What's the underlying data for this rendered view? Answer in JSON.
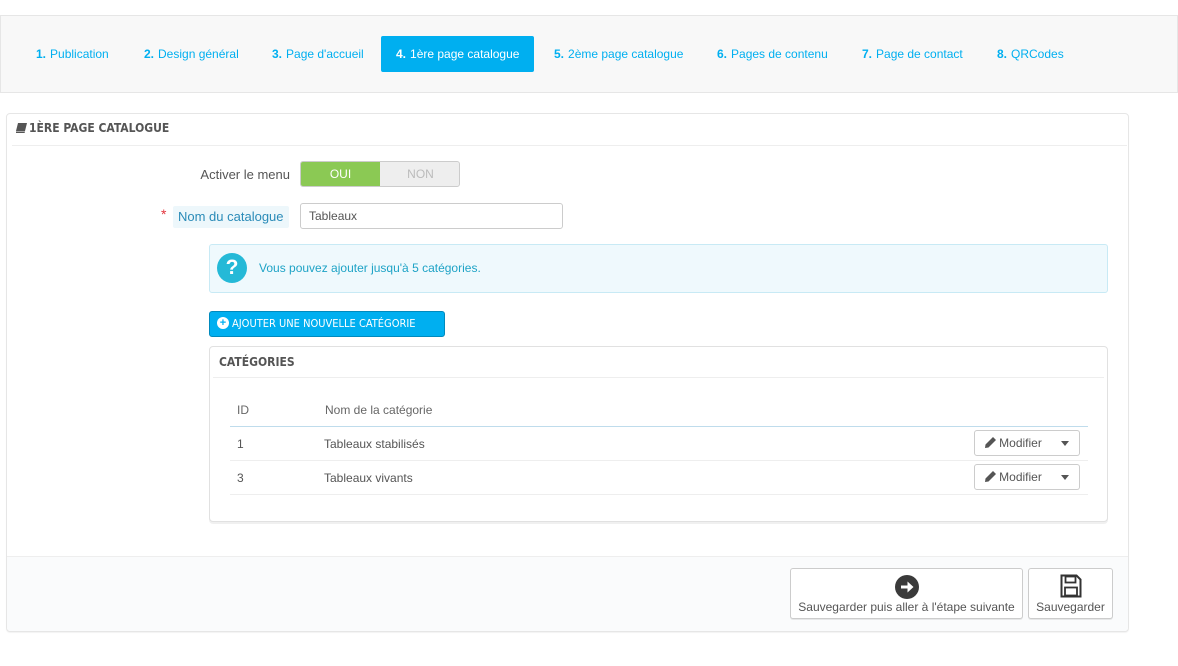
{
  "steps": [
    {
      "num": "1.",
      "label": "Publication"
    },
    {
      "num": "2.",
      "label": "Design général"
    },
    {
      "num": "3.",
      "label": "Page d'accueil"
    },
    {
      "num": "4.",
      "label": "1ère page catalogue"
    },
    {
      "num": "5.",
      "label": "2ème page catalogue"
    },
    {
      "num": "6.",
      "label": "Pages de contenu"
    },
    {
      "num": "7.",
      "label": "Page de contact"
    },
    {
      "num": "8.",
      "label": "QRCodes"
    }
  ],
  "active_step": 3,
  "panel": {
    "title": "1ère page catalogue",
    "menu_label": "Activer le menu",
    "switch_on": "OUI",
    "switch_off": "NON",
    "switch_value": "OUI",
    "catalogue_label": "Nom du catalogue",
    "required_mark": "*",
    "catalogue_value": "Tableaux",
    "info_icon": "?",
    "info_text": "Vous pouvez ajouter jusqu'à 5 catégories.",
    "add_button": "Ajouter une nouvelle catégorie"
  },
  "categories": {
    "title": "Catégories",
    "columns": [
      "ID",
      "Nom de la catégorie"
    ],
    "rows": [
      {
        "id": "1",
        "name": "Tableaux stabilisés",
        "action": "Modifier"
      },
      {
        "id": "3",
        "name": "Tableaux vivants",
        "action": "Modifier"
      }
    ]
  },
  "footer": {
    "save_next": "Sauvegarder puis aller à l'étape suivante",
    "save": "Sauvegarder"
  },
  "colors": {
    "accent": "#00aff0",
    "switch_on": "#8bc954",
    "required": "#e3343d"
  }
}
